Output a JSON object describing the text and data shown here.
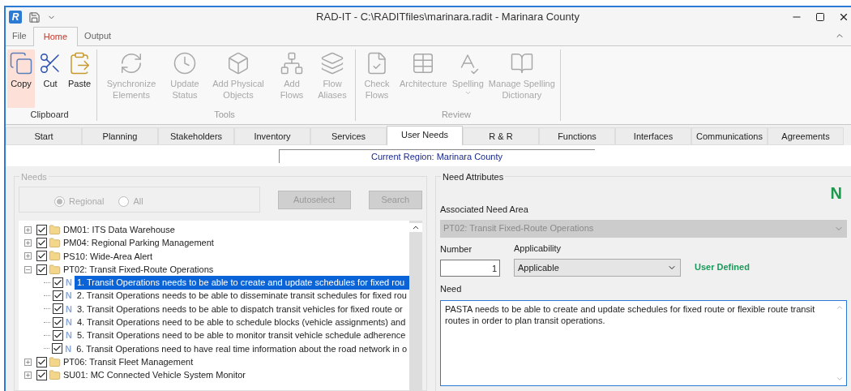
{
  "window": {
    "title": "RAD-IT - C:\\RADITfiles\\marinara.radit - Marinara County",
    "app_letter": "R"
  },
  "ribbon_tabs": [
    {
      "label": "File",
      "selected": false
    },
    {
      "label": "Home",
      "selected": true
    },
    {
      "label": "Output",
      "selected": false
    }
  ],
  "ribbon_groups": [
    {
      "label": "Clipboard",
      "items": [
        {
          "kind": "copy",
          "label": "Copy",
          "disabled": false,
          "selected": true
        },
        {
          "kind": "cut",
          "label": "Cut",
          "disabled": false,
          "selected": false
        },
        {
          "kind": "paste",
          "label": "Paste",
          "disabled": false,
          "selected": false
        }
      ]
    },
    {
      "label": "Tools",
      "items": [
        {
          "kind": "sync",
          "label": "Synchronize Elements",
          "disabled": true,
          "selected": false
        },
        {
          "kind": "clock",
          "label": "Update Status",
          "disabled": true,
          "selected": false
        },
        {
          "kind": "cube",
          "label": "Add Physical Objects",
          "disabled": true,
          "selected": false
        },
        {
          "kind": "flows",
          "label": "Add Flows",
          "disabled": true,
          "selected": false
        },
        {
          "kind": "aliases",
          "label": "Flow Aliases",
          "disabled": true,
          "selected": false
        }
      ]
    },
    {
      "label": "Review",
      "items": [
        {
          "kind": "check",
          "label": "Check Flows",
          "disabled": true,
          "selected": false
        },
        {
          "kind": "arch",
          "label": "Architecture",
          "disabled": true,
          "selected": false
        },
        {
          "kind": "spell",
          "label": "Spelling",
          "disabled": true,
          "selected": false
        },
        {
          "kind": "book",
          "label": "Manage Spelling Dictionary",
          "disabled": true,
          "selected": false
        }
      ]
    }
  ],
  "main_tabs": [
    {
      "label": "Start",
      "selected": false
    },
    {
      "label": "Planning",
      "selected": false
    },
    {
      "label": "Stakeholders",
      "selected": false
    },
    {
      "label": "Inventory",
      "selected": false
    },
    {
      "label": "Services",
      "selected": false
    },
    {
      "label": "User Needs",
      "selected": true
    },
    {
      "label": "R & R",
      "selected": false
    },
    {
      "label": "Functions",
      "selected": false
    },
    {
      "label": "Interfaces",
      "selected": false
    },
    {
      "label": "Communications",
      "selected": false
    },
    {
      "label": "Agreements",
      "selected": false
    }
  ],
  "current_region": "Current Region: Marinara County",
  "needs": {
    "title": "Needs",
    "radios": [
      {
        "label": "Regional",
        "selected": true
      },
      {
        "label": "All",
        "selected": false
      }
    ],
    "buttons": [
      {
        "label": "Autoselect",
        "disabled": true
      },
      {
        "label": "Search",
        "disabled": true
      }
    ],
    "tree": [
      {
        "label": "DM01: ITS Data Warehouse",
        "checked": true,
        "expanded": false,
        "selected": false
      },
      {
        "label": "PM04: Regional Parking Management",
        "checked": true,
        "expanded": false,
        "selected": false
      },
      {
        "label": "PS10: Wide-Area Alert",
        "checked": true,
        "expanded": false,
        "selected": false
      },
      {
        "label": "PT02: Transit Fixed-Route Operations",
        "checked": true,
        "expanded": true,
        "selected": false,
        "children": [
          {
            "marker": "N",
            "label": "1. Transit Operations needs to be able to create and update schedules for fixed rou",
            "checked": true,
            "selected": true
          },
          {
            "marker": "N",
            "label": "2. Transit Operations needs to be able to disseminate transit schedules for fixed rou",
            "checked": true,
            "selected": false
          },
          {
            "marker": "N",
            "label": "3. Transit Operations needs to be able to dispatch transit vehicles for fixed route or",
            "checked": true,
            "selected": false
          },
          {
            "marker": "N",
            "label": "4. Transit Operations need to be able to schedule blocks (vehicle assignments) and",
            "checked": true,
            "selected": false
          },
          {
            "marker": "N",
            "label": "5. Transit Operations need to be able to monitor transit vehicle schedule adherence",
            "checked": true,
            "selected": false
          },
          {
            "marker": "N",
            "label": "6. Transit Operations need to have real time information about the road network in o",
            "checked": true,
            "selected": false
          }
        ]
      },
      {
        "label": "PT06: Transit Fleet Management",
        "checked": true,
        "expanded": false,
        "selected": false
      },
      {
        "label": "SU01: MC Connected Vehicle System Monitor",
        "checked": true,
        "expanded": false,
        "selected": false
      }
    ]
  },
  "attributes": {
    "title": "Need Attributes",
    "badge": "N",
    "area_label": "Associated Need Area",
    "area_value": "PT02: Transit Fixed-Route Operations",
    "number_label": "Number",
    "number_value": "1",
    "applicability_label": "Applicability",
    "applicability_value": "Applicable",
    "status": "User Defined",
    "need_label": "Need",
    "need_value": "PASTA needs to be able to create and update schedules for fixed route or flexible route transit routes in order to plan transit operations."
  }
}
